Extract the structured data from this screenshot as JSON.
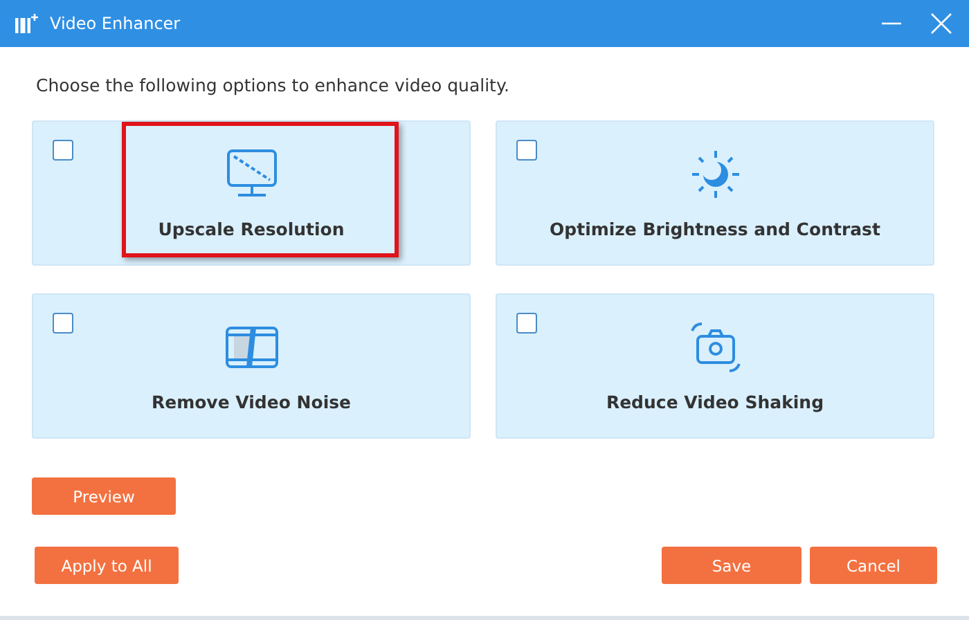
{
  "window": {
    "title": "Video Enhancer"
  },
  "instruction": "Choose the following options to enhance video quality.",
  "options": [
    {
      "kind": "resolution",
      "label": "Upscale Resolution",
      "checked": false,
      "highlighted": true
    },
    {
      "kind": "brightness",
      "label": "Optimize Brightness and Contrast",
      "checked": false,
      "highlighted": false
    },
    {
      "kind": "noise",
      "label": "Remove Video Noise",
      "checked": false,
      "highlighted": false
    },
    {
      "kind": "shaking",
      "label": "Reduce Video Shaking",
      "checked": false,
      "highlighted": false
    }
  ],
  "preview_button": "Preview",
  "buttons": {
    "apply": "Apply to All",
    "save": "Save",
    "cancel": "Cancel"
  }
}
